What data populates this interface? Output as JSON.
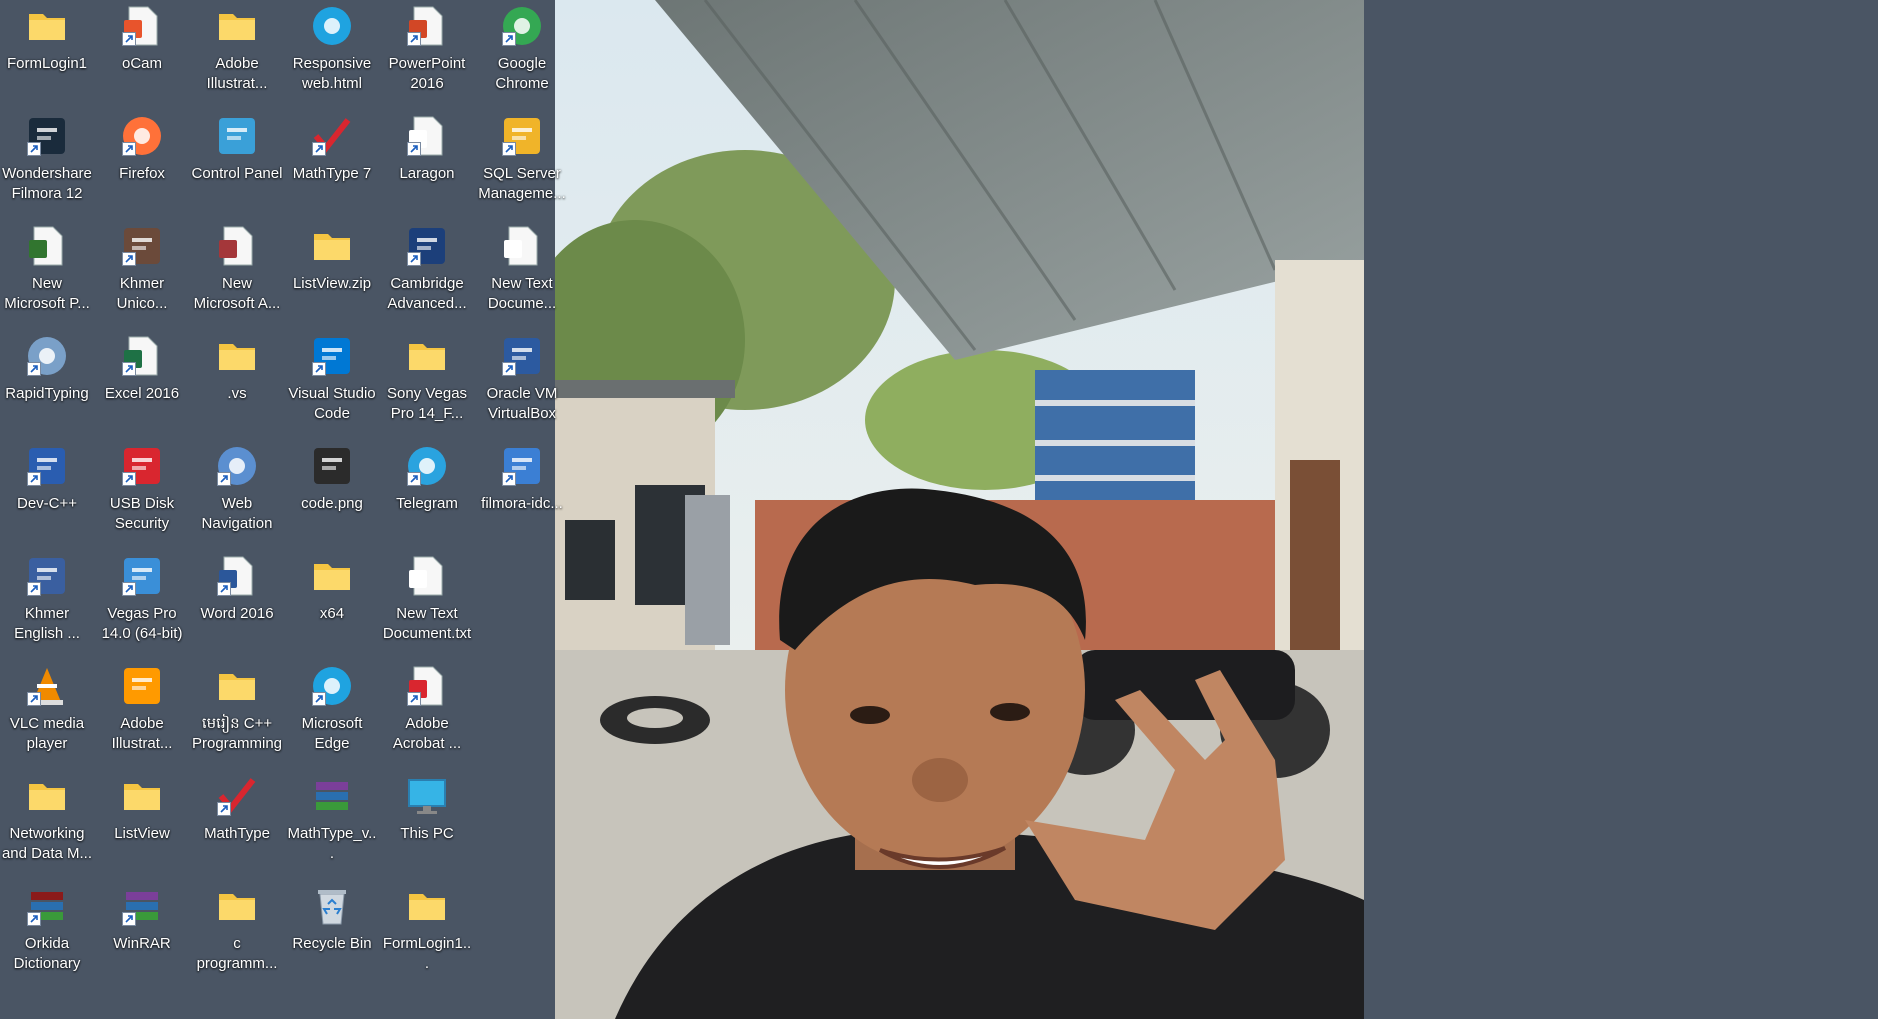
{
  "desktop": {
    "icons": [
      {
        "label": "FormLogin1",
        "icon": "folder-icon",
        "kind": "folder",
        "color": "#f5c542",
        "shortcut": false
      },
      {
        "label": "oCam",
        "icon": "ocam-icon",
        "kind": "doc",
        "color": "#e8542c",
        "shortcut": true
      },
      {
        "label": "Adobe Illustrat...",
        "icon": "folder-icon",
        "kind": "folder",
        "color": "#f5c542",
        "shortcut": false
      },
      {
        "label": "Responsive web.html",
        "icon": "edge-icon",
        "kind": "circle",
        "color": "#1fa3e0",
        "shortcut": false
      },
      {
        "label": "PowerPoint 2016",
        "icon": "powerpoint-icon",
        "kind": "doc",
        "color": "#d24726",
        "shortcut": true
      },
      {
        "label": "Google Chrome",
        "icon": "chrome-icon",
        "kind": "circle",
        "color": "#34a853",
        "shortcut": true
      },
      {
        "label": "Wondershare Filmora 12",
        "icon": "filmora-icon",
        "kind": "square",
        "color": "#1a2b3c",
        "shortcut": true
      },
      {
        "label": "Firefox",
        "icon": "firefox-icon",
        "kind": "circle",
        "color": "#ff7139",
        "shortcut": true
      },
      {
        "label": "Control Panel",
        "icon": "control-panel-icon",
        "kind": "square",
        "color": "#3aa0d8",
        "shortcut": false
      },
      {
        "label": "MathType 7",
        "icon": "mathtype-icon",
        "kind": "check",
        "color": "#d9262f",
        "shortcut": true
      },
      {
        "label": "Laragon",
        "icon": "file-icon",
        "kind": "doc",
        "color": "#ffffff",
        "shortcut": true
      },
      {
        "label": "SQL Server Manageme...",
        "icon": "sql-server-icon",
        "kind": "square",
        "color": "#f0b429",
        "shortcut": true
      },
      {
        "label": "New Microsoft P...",
        "icon": "project-icon",
        "kind": "doc",
        "color": "#31752f",
        "shortcut": false
      },
      {
        "label": "Khmer Unico...",
        "icon": "keyboard-icon",
        "kind": "square",
        "color": "#6b4a3a",
        "shortcut": true
      },
      {
        "label": "New Microsoft A...",
        "icon": "access-icon",
        "kind": "doc",
        "color": "#a4373a",
        "shortcut": false
      },
      {
        "label": "ListView.zip",
        "icon": "zip-folder-icon",
        "kind": "folder",
        "color": "#f5c542",
        "shortcut": false
      },
      {
        "label": "Cambridge Advanced...",
        "icon": "cambridge-icon",
        "kind": "square",
        "color": "#1c3f7a",
        "shortcut": true
      },
      {
        "label": "New Text Docume...",
        "icon": "text-file-icon",
        "kind": "doc",
        "color": "#ffffff",
        "shortcut": false
      },
      {
        "label": "RapidTyping",
        "icon": "rapidtyping-icon",
        "kind": "circle",
        "color": "#7aa0c8",
        "shortcut": true
      },
      {
        "label": "Excel 2016",
        "icon": "excel-icon",
        "kind": "doc",
        "color": "#1e7145",
        "shortcut": true
      },
      {
        "label": ".vs",
        "icon": "folder-icon",
        "kind": "folder",
        "color": "#f5c542",
        "shortcut": false
      },
      {
        "label": "Visual Studio Code",
        "icon": "vscode-icon",
        "kind": "square",
        "color": "#0078d4",
        "shortcut": true
      },
      {
        "label": "Sony Vegas Pro 14_F...",
        "icon": "folder-icon",
        "kind": "folder",
        "color": "#f5c542",
        "shortcut": false
      },
      {
        "label": "Oracle VM VirtualBox",
        "icon": "virtualbox-icon",
        "kind": "square",
        "color": "#2c5aa0",
        "shortcut": true
      },
      {
        "label": "Dev-C++",
        "icon": "devcpp-icon",
        "kind": "square",
        "color": "#2a5db0",
        "shortcut": true
      },
      {
        "label": "USB Disk Security",
        "icon": "shield-icon",
        "kind": "square",
        "color": "#d9262f",
        "shortcut": true
      },
      {
        "label": "Web Navigation",
        "icon": "globe-icon",
        "kind": "circle",
        "color": "#5b8fd0",
        "shortcut": true
      },
      {
        "label": "code.png",
        "icon": "image-file-icon",
        "kind": "square",
        "color": "#2b2b2b",
        "shortcut": false
      },
      {
        "label": "Telegram",
        "icon": "telegram-icon",
        "kind": "circle",
        "color": "#2aa3df",
        "shortcut": true
      },
      {
        "label": "filmora-idc...",
        "icon": "installer-icon",
        "kind": "square",
        "color": "#3b7fd4",
        "shortcut": true
      },
      {
        "label": "Khmer English ...",
        "icon": "dictionary-icon",
        "kind": "square",
        "color": "#3a5fa0",
        "shortcut": true
      },
      {
        "label": "Vegas Pro 14.0 (64-bit)",
        "icon": "vegas-icon",
        "kind": "square",
        "color": "#3a8fd8",
        "shortcut": true
      },
      {
        "label": "Word 2016",
        "icon": "word-icon",
        "kind": "doc",
        "color": "#2b579a",
        "shortcut": true
      },
      {
        "label": "x64",
        "icon": "folder-icon",
        "kind": "folder",
        "color": "#f5c542",
        "shortcut": false
      },
      {
        "label": "New Text Document.txt",
        "icon": "text-file-icon",
        "kind": "doc",
        "color": "#ffffff",
        "shortcut": false
      },
      {
        "label": "",
        "icon": "",
        "kind": "none",
        "color": "",
        "shortcut": false
      },
      {
        "label": "VLC media player",
        "icon": "vlc-icon",
        "kind": "cone",
        "color": "#f08a00",
        "shortcut": true
      },
      {
        "label": "Adobe Illustrat...",
        "icon": "illustrator-icon",
        "kind": "square",
        "color": "#ff9a00",
        "shortcut": false
      },
      {
        "label": "មេរៀន C++ Programming",
        "icon": "folder-icon",
        "kind": "folder",
        "color": "#f5c542",
        "shortcut": false
      },
      {
        "label": "Microsoft Edge",
        "icon": "edge-icon",
        "kind": "circle",
        "color": "#1fa3e0",
        "shortcut": true
      },
      {
        "label": "Adobe Acrobat ...",
        "icon": "acrobat-icon",
        "kind": "doc",
        "color": "#d9262f",
        "shortcut": true
      },
      {
        "label": "",
        "icon": "",
        "kind": "none",
        "color": "",
        "shortcut": false
      },
      {
        "label": "Networking and Data M...",
        "icon": "folder-icon",
        "kind": "folder",
        "color": "#f5c542",
        "shortcut": false
      },
      {
        "label": "ListView",
        "icon": "folder-icon",
        "kind": "folder",
        "color": "#f5c542",
        "shortcut": false
      },
      {
        "label": "MathType",
        "icon": "mathtype-icon",
        "kind": "check",
        "color": "#d9262f",
        "shortcut": true
      },
      {
        "label": "MathType_v...",
        "icon": "winrar-archive-icon",
        "kind": "books",
        "color": "#7b3f9a",
        "shortcut": false
      },
      {
        "label": "This PC",
        "icon": "monitor-icon",
        "kind": "monitor",
        "color": "#36b4e6",
        "shortcut": false
      },
      {
        "label": "",
        "icon": "",
        "kind": "none",
        "color": "",
        "shortcut": false
      },
      {
        "label": "Orkida Dictionary",
        "icon": "orkida-icon",
        "kind": "books",
        "color": "#8b1a1a",
        "shortcut": true
      },
      {
        "label": "WinRAR",
        "icon": "winrar-icon",
        "kind": "books",
        "color": "#7b3f9a",
        "shortcut": true
      },
      {
        "label": "c programm...",
        "icon": "folder-icon",
        "kind": "folder",
        "color": "#f5c542",
        "shortcut": false
      },
      {
        "label": "Recycle Bin",
        "icon": "recycle-bin-icon",
        "kind": "bin",
        "color": "#d0d8e0",
        "shortcut": false
      },
      {
        "label": "FormLogin1...",
        "icon": "zip-folder-icon",
        "kind": "folder",
        "color": "#f5c542",
        "shortcut": false
      },
      {
        "label": "",
        "icon": "",
        "kind": "none",
        "color": "",
        "shortcut": false
      }
    ]
  }
}
